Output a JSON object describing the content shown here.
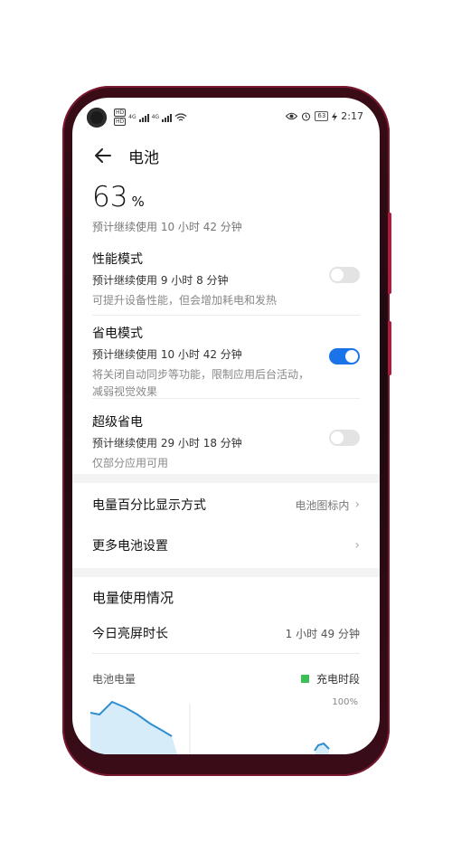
{
  "statusbar": {
    "left_tags": [
      "HD",
      "HD"
    ],
    "net_labels": [
      "4G",
      "4G"
    ],
    "battery_level": "63",
    "time": "2:17"
  },
  "header": {
    "title": "电池"
  },
  "battery": {
    "percent": "63",
    "unit": "%",
    "remaining": "预计继续使用 10 小时 42 分钟"
  },
  "modes": [
    {
      "title": "性能模式",
      "estimate": "预计继续使用 9 小时 8 分钟",
      "desc": "可提升设备性能，但会增加耗电和发热",
      "enabled": false
    },
    {
      "title": "省电模式",
      "estimate": "预计继续使用 10 小时 42 分钟",
      "desc": "将关闭自动同步等功能，限制应用后台活动，减弱视觉效果",
      "enabled": true
    },
    {
      "title": "超级省电",
      "estimate": "预计继续使用 29 小时 18 分钟",
      "desc": "仅部分应用可用",
      "enabled": false
    }
  ],
  "settings": {
    "percent_display": {
      "label": "电量百分比显示方式",
      "value": "电池图标内"
    },
    "more": {
      "label": "更多电池设置"
    }
  },
  "usage": {
    "title": "电量使用情况",
    "screen_time_label": "今日亮屏时长",
    "screen_time_value": "1 小时 49 分钟",
    "chart_label": "电池电量",
    "legend_charging": "充电时段",
    "max_label": "100%"
  },
  "colors": {
    "accent": "#1a73e8",
    "charging": "#3dbf55",
    "frame": "#b01b3c"
  }
}
